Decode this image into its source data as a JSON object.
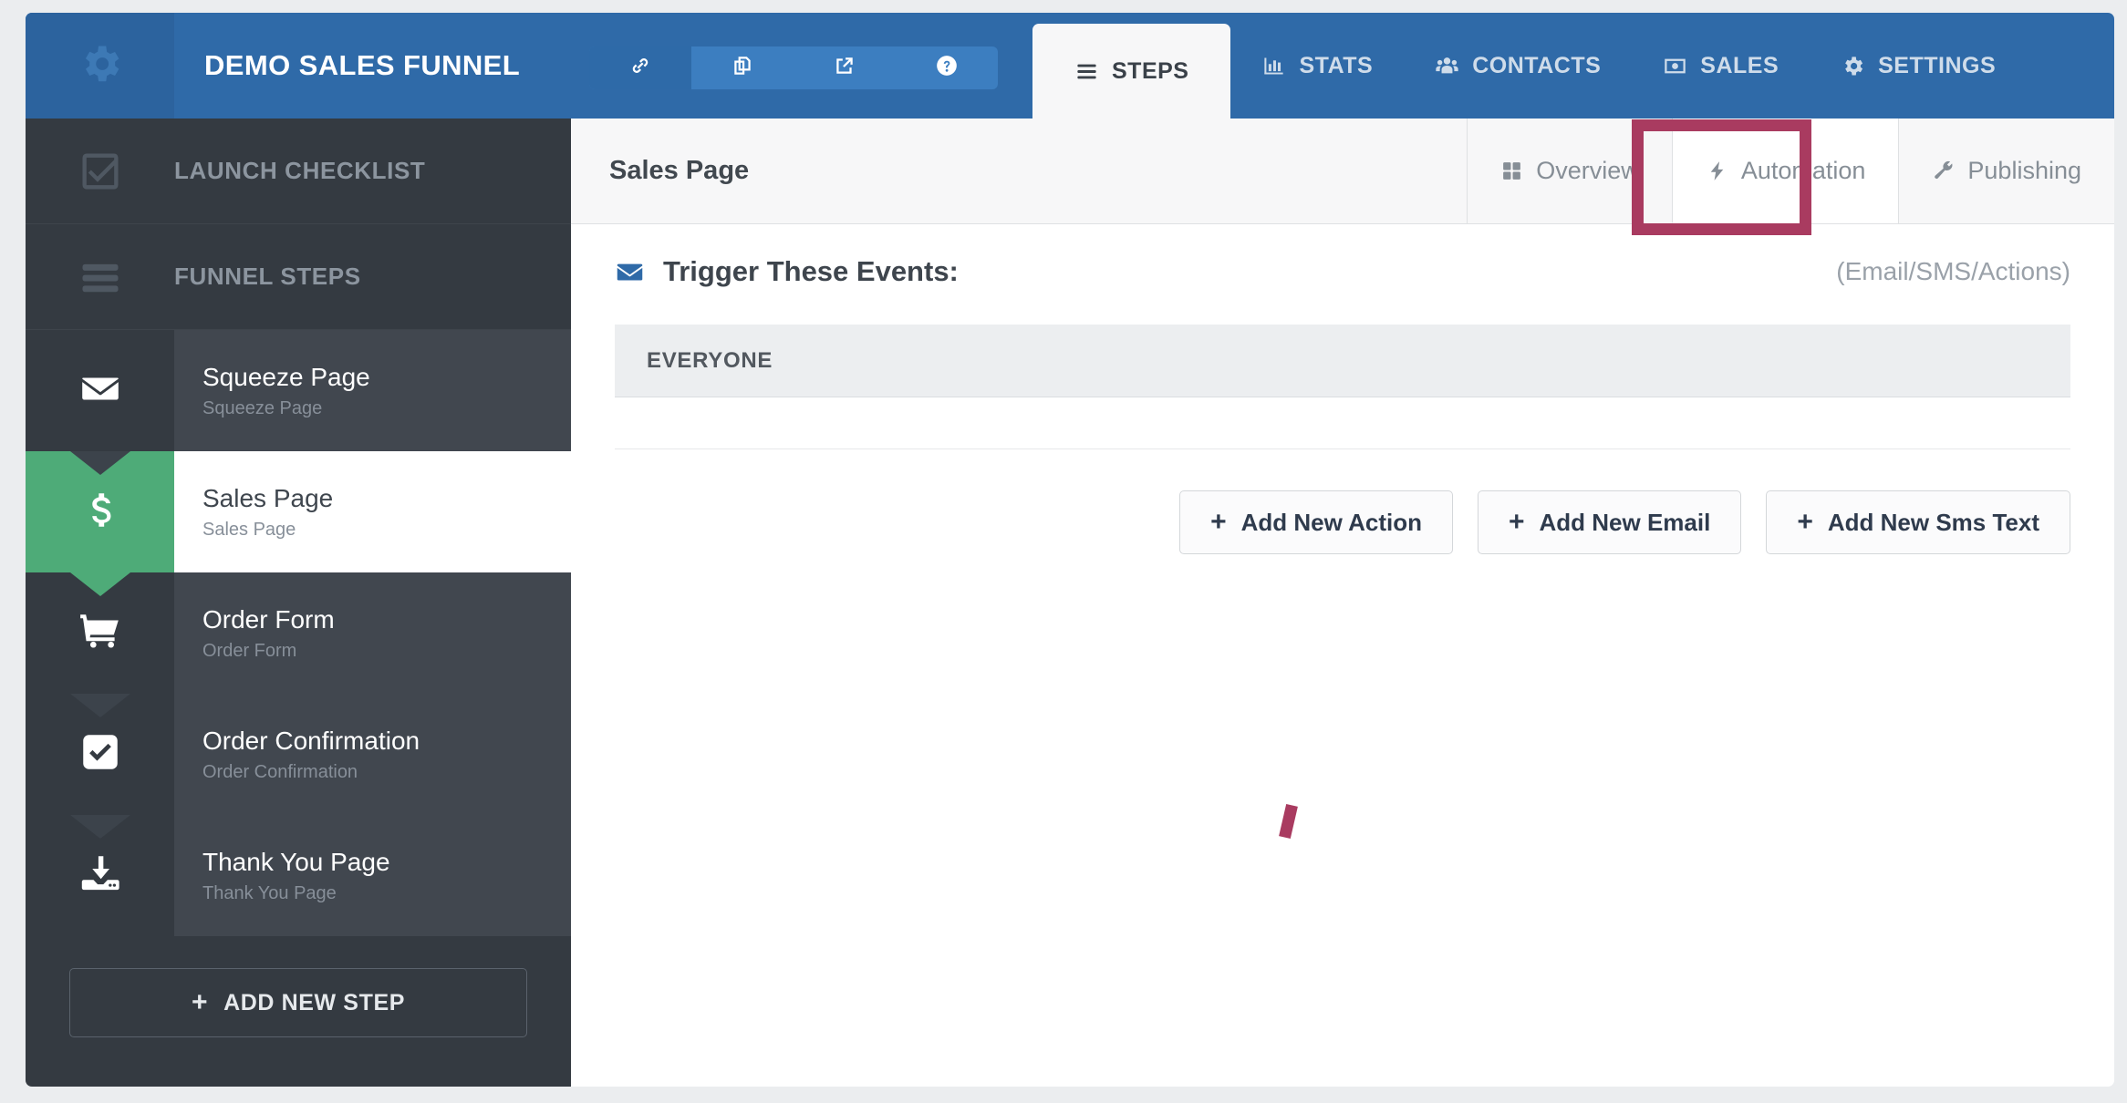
{
  "header": {
    "gear_icon": "gear-icon",
    "funnel_title": "DEMO SALES FUNNEL",
    "icon_buttons": [
      {
        "name": "link-icon",
        "label": "Link"
      },
      {
        "name": "copy-icon",
        "label": "Clone"
      },
      {
        "name": "external-link-icon",
        "label": "Open"
      },
      {
        "name": "help-icon",
        "label": "Help"
      }
    ],
    "nav_tabs": [
      {
        "label": "STEPS",
        "icon": "hamburger-icon",
        "active": true
      },
      {
        "label": "STATS",
        "icon": "bar-chart-icon",
        "active": false
      },
      {
        "label": "CONTACTS",
        "icon": "people-icon",
        "active": false
      },
      {
        "label": "SALES",
        "icon": "money-icon",
        "active": false
      },
      {
        "label": "SETTINGS",
        "icon": "gear-icon",
        "active": false
      }
    ]
  },
  "sidebar": {
    "sections": [
      {
        "label": "LAUNCH CHECKLIST",
        "icon": "checkbox-check-icon"
      },
      {
        "label": "FUNNEL STEPS",
        "icon": "hamburger-icon"
      }
    ],
    "steps": [
      {
        "title": "Squeeze Page",
        "subtitle": "Squeeze Page",
        "icon": "envelope-icon",
        "active": false
      },
      {
        "title": "Sales Page",
        "subtitle": "Sales Page",
        "icon": "dollar-icon",
        "active": true
      },
      {
        "title": "Order Form",
        "subtitle": "Order Form",
        "icon": "cart-icon",
        "active": false
      },
      {
        "title": "Order Confirmation",
        "subtitle": "Order Confirmation",
        "icon": "checkbox-check-icon",
        "active": false
      },
      {
        "title": "Thank You Page",
        "subtitle": "Thank You Page",
        "icon": "download-icon",
        "active": false
      }
    ],
    "add_step_label": "ADD NEW STEP",
    "add_step_plus": "+"
  },
  "content": {
    "page_name": "Sales Page",
    "tabs": [
      {
        "label": "Overview",
        "icon": "grid-icon",
        "active": false
      },
      {
        "label": "Automation",
        "icon": "bolt-icon",
        "active": true,
        "highlighted": true
      },
      {
        "label": "Publishing",
        "icon": "wrench-icon",
        "active": false
      }
    ],
    "trigger_title": "Trigger These Events:",
    "trigger_icon": "envelope-icon",
    "trigger_note": "(Email/SMS/Actions)",
    "everyone_label": "EVERYONE",
    "action_buttons": [
      {
        "plus": "+",
        "label": "Add New Action"
      },
      {
        "plus": "+",
        "label": "Add New Email"
      },
      {
        "plus": "+",
        "label": "Add New Sms Text"
      }
    ]
  },
  "colors": {
    "header_blue": "#2f6aa8",
    "sidebar_dark": "#343a41",
    "sidebar_step": "#41474f",
    "active_green": "#4eab78",
    "highlight_crimson": "#a93b60",
    "page_bg": "#ebedef"
  }
}
